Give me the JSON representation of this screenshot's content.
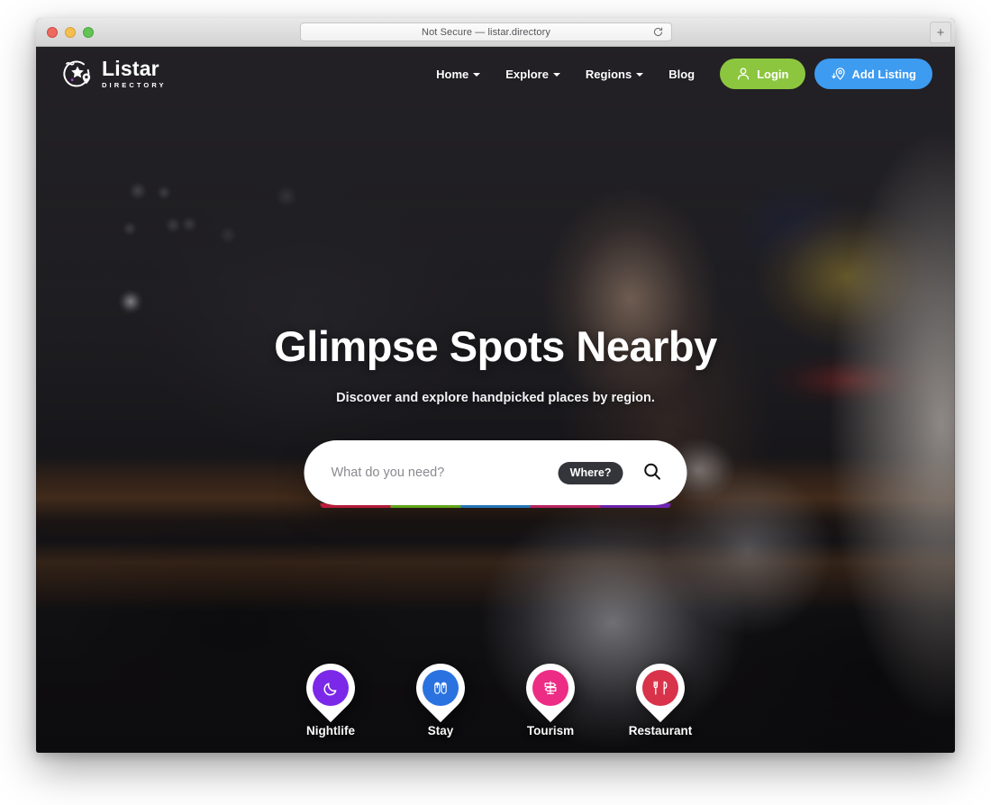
{
  "browser": {
    "url_text": "Not Secure — listar.directory",
    "reload_title": "Reload",
    "newtab_label": "+"
  },
  "header": {
    "logo": {
      "name": "Listar",
      "subtitle": "DIRECTORY"
    },
    "nav_items": [
      {
        "label": "Home",
        "has_caret": true
      },
      {
        "label": "Explore",
        "has_caret": true
      },
      {
        "label": "Regions",
        "has_caret": true
      },
      {
        "label": "Blog",
        "has_caret": false
      }
    ],
    "login_label": "Login",
    "add_listing_label": "Add Listing",
    "login_color": "#8cc63f",
    "add_listing_color": "#3d9bf0"
  },
  "hero": {
    "title": "Glimpse Spots Nearby",
    "subtitle": "Discover and explore handpicked places by region."
  },
  "search": {
    "placeholder": "What do you need?",
    "value": "",
    "where_label": "Where?",
    "strip_colors": [
      "#e8234a",
      "#7ed321",
      "#2f9bf0",
      "#ef2d7e",
      "#8b2bdd"
    ]
  },
  "categories": [
    {
      "label": "Nightlife",
      "icon": "moon-icon",
      "color": "#7b28e8"
    },
    {
      "label": "Stay",
      "icon": "sandals-icon",
      "color": "#2a72e0"
    },
    {
      "label": "Tourism",
      "icon": "signpost-icon",
      "color": "#ec2c85"
    },
    {
      "label": "Restaurant",
      "icon": "cutlery-icon",
      "color": "#d8334a"
    }
  ]
}
